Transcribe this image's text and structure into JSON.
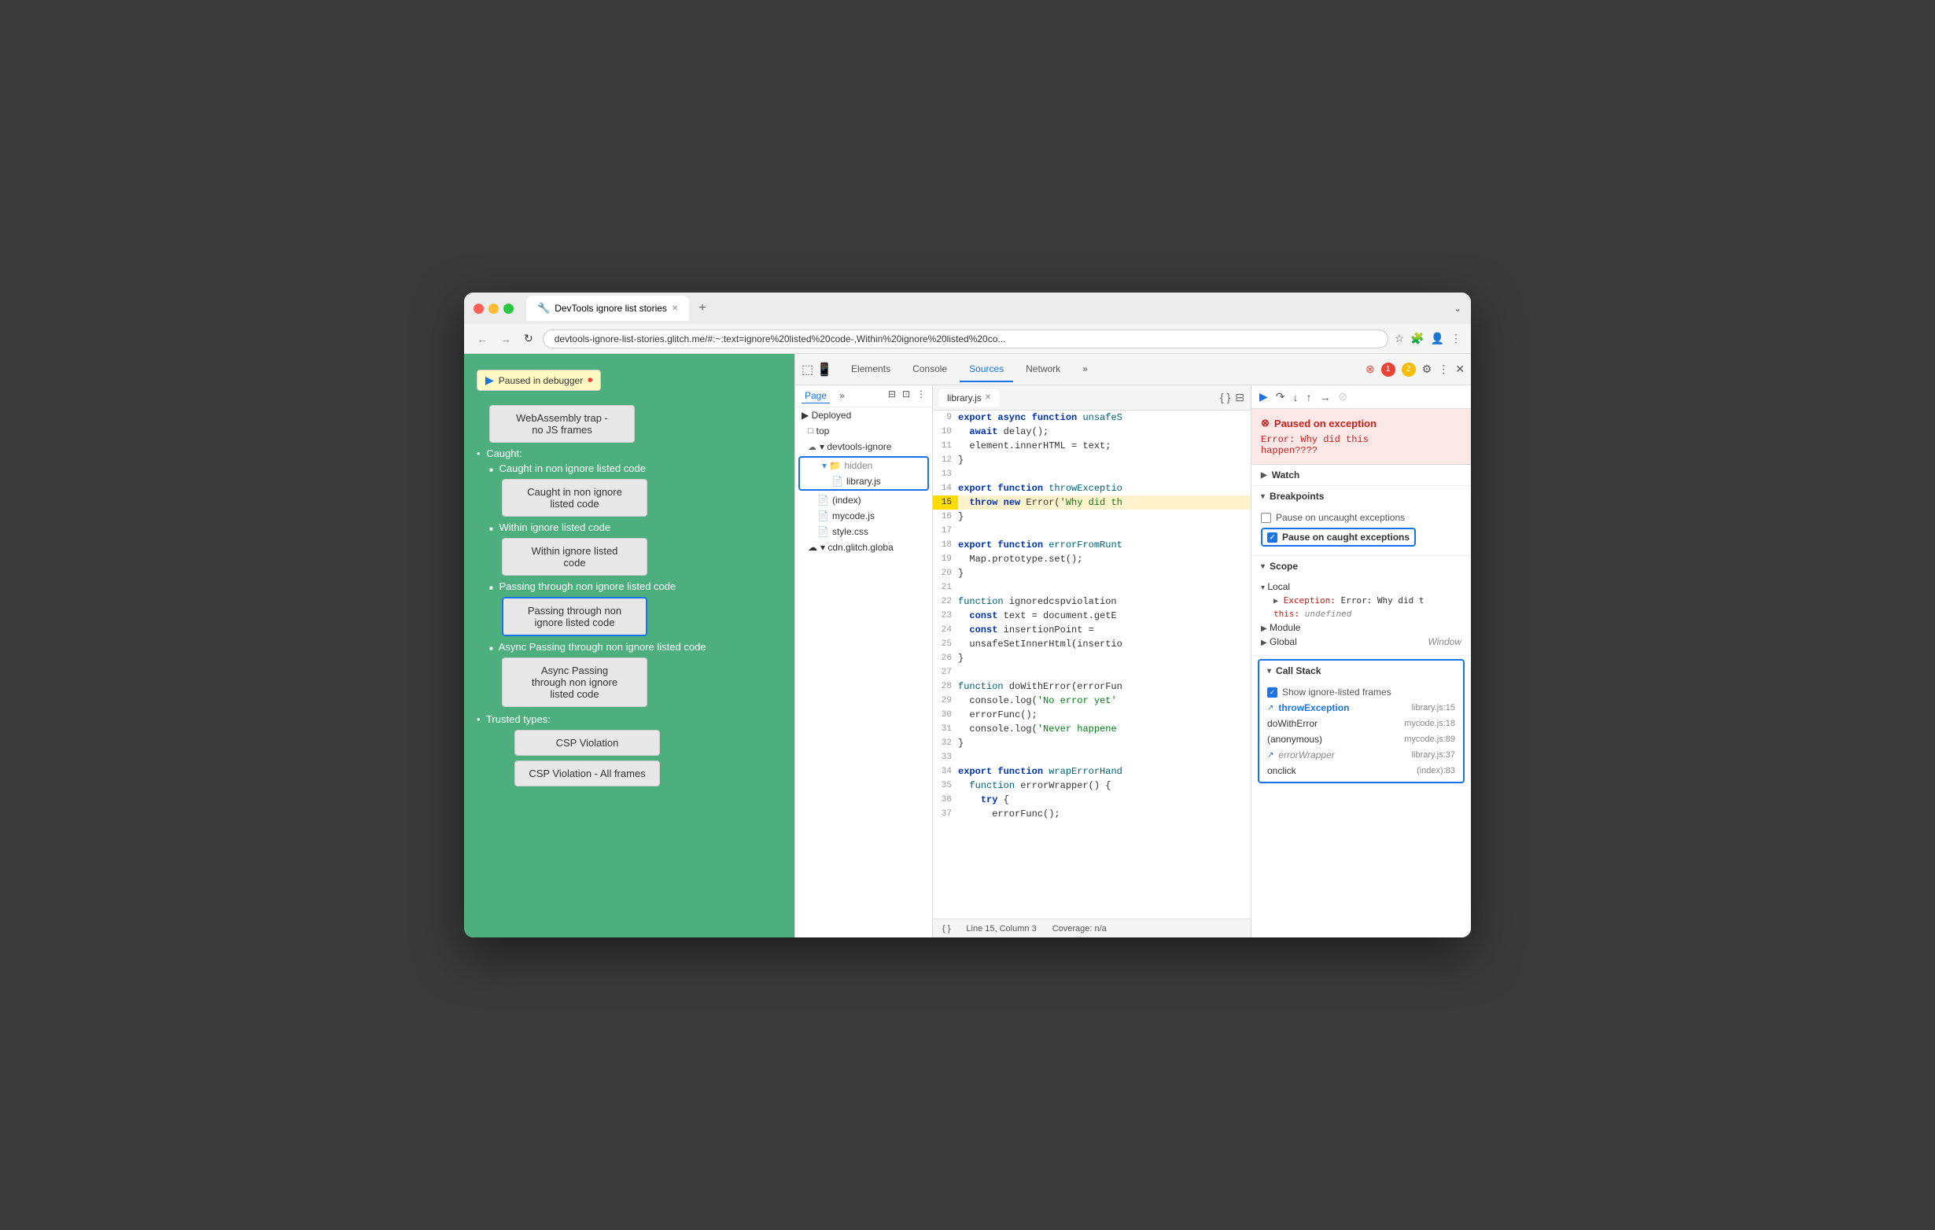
{
  "window": {
    "title": "DevTools ignore list stories",
    "url": "devtools-ignore-list-stories.glitch.me/#:~:text=ignore%20listed%20code-,Within%20ignore%20listed%20co..."
  },
  "browser": {
    "back": "←",
    "forward": "→",
    "refresh": "↻",
    "menu": "⋮"
  },
  "webpage": {
    "paused_label": "Paused in debugger",
    "webasm_label": "WebAssembly trap - no JS frames",
    "caught_heading": "Caught:",
    "items": [
      {
        "label": "Caught in non ignore listed code",
        "has_button": true,
        "button_label": "Caught in non ignore\nlisted code",
        "highlighted": false
      },
      {
        "label": "Within ignore listed code",
        "has_button": true,
        "button_label": "Within ignore listed\ncode",
        "highlighted": false
      },
      {
        "label": "Passing through non ignore listed code",
        "has_button": true,
        "button_label": "Passing through non\nignore listed code",
        "highlighted": true
      },
      {
        "label": "Async Passing through non ignore listed code",
        "has_button": true,
        "button_label": "Async Passing\nthrough non ignore\nlisted code",
        "highlighted": false
      }
    ],
    "trusted_heading": "Trusted types:",
    "csp_items": [
      {
        "label": "CSP Violation"
      },
      {
        "label": "CSP Violation - All frames"
      }
    ]
  },
  "devtools": {
    "tabs": [
      "Elements",
      "Console",
      "Sources",
      "Network",
      "»"
    ],
    "active_tab": "Sources",
    "error_count": "1",
    "warn_count": "2"
  },
  "sources": {
    "sidebar_tabs": [
      "Page",
      "»"
    ],
    "file_tree": {
      "items": [
        {
          "label": "Deployed",
          "type": "section",
          "indent": 0
        },
        {
          "label": "top",
          "type": "folder",
          "indent": 1,
          "icon": "□"
        },
        {
          "label": "devtools-ignore",
          "type": "cloud-folder",
          "indent": 1,
          "icon": "☁",
          "expanded": true
        },
        {
          "label": "hidden",
          "type": "folder",
          "indent": 2,
          "highlighted": true
        },
        {
          "label": "library.js",
          "type": "file-orange",
          "indent": 3
        },
        {
          "label": "(index)",
          "type": "file",
          "indent": 2
        },
        {
          "label": "mycode.js",
          "type": "file-red",
          "indent": 2
        },
        {
          "label": "style.css",
          "type": "file-red",
          "indent": 2
        },
        {
          "label": "cdn.glitch.globa",
          "type": "cloud-folder",
          "indent": 1,
          "icon": "☁"
        }
      ]
    },
    "active_file": "library.js",
    "code_lines": [
      {
        "num": 9,
        "content": "export async function unsafeS",
        "highlight": false
      },
      {
        "num": 10,
        "content": "  await delay();",
        "highlight": false
      },
      {
        "num": 11,
        "content": "  element.innerHTML = text;",
        "highlight": false
      },
      {
        "num": 12,
        "content": "}",
        "highlight": false
      },
      {
        "num": 13,
        "content": "",
        "highlight": false
      },
      {
        "num": 14,
        "content": "export function throwExceptio",
        "highlight": false
      },
      {
        "num": 15,
        "content": "  throw new Error('Why did th",
        "highlight": true
      },
      {
        "num": 16,
        "content": "}",
        "highlight": false
      },
      {
        "num": 17,
        "content": "",
        "highlight": false
      },
      {
        "num": 18,
        "content": "export function errorFromRunt",
        "highlight": false
      },
      {
        "num": 19,
        "content": "  Map.prototype.set();",
        "highlight": false
      },
      {
        "num": 20,
        "content": "}",
        "highlight": false
      },
      {
        "num": 21,
        "content": "",
        "highlight": false
      },
      {
        "num": 22,
        "content": "function ignoredcspviolation",
        "highlight": false
      },
      {
        "num": 23,
        "content": "  const text = document.getE",
        "highlight": false
      },
      {
        "num": 24,
        "content": "  const insertionPoint =",
        "highlight": false
      },
      {
        "num": 25,
        "content": "  unsafeSetInnerHtml(insertio",
        "highlight": false
      },
      {
        "num": 26,
        "content": "}",
        "highlight": false
      },
      {
        "num": 27,
        "content": "",
        "highlight": false
      },
      {
        "num": 28,
        "content": "function doWithError(errorFun",
        "highlight": false
      },
      {
        "num": 29,
        "content": "  console.log('No error yet'",
        "highlight": false
      },
      {
        "num": 30,
        "content": "  errorFunc();",
        "highlight": false
      },
      {
        "num": 31,
        "content": "  console.log('Never happene",
        "highlight": false
      },
      {
        "num": 32,
        "content": "}",
        "highlight": false
      },
      {
        "num": 33,
        "content": "",
        "highlight": false
      },
      {
        "num": 34,
        "content": "export function wrapErrorHand",
        "highlight": false
      },
      {
        "num": 35,
        "content": "  function errorWrapper() {",
        "highlight": false
      },
      {
        "num": 36,
        "content": "    try {",
        "highlight": false
      },
      {
        "num": 37,
        "content": "      errorFunc();",
        "highlight": false
      }
    ],
    "status_line": "Line 15, Column 3",
    "coverage": "Coverage: n/a"
  },
  "right_panel": {
    "exception": {
      "title": "Paused on exception",
      "message": "Error: Why did this\nhappen????"
    },
    "sections": [
      {
        "id": "watch",
        "label": "Watch",
        "collapsed": true
      },
      {
        "id": "breakpoints",
        "label": "Breakpoints",
        "collapsed": false
      },
      {
        "id": "scope",
        "label": "Scope",
        "collapsed": false
      },
      {
        "id": "callstack",
        "label": "Call Stack",
        "collapsed": false
      }
    ],
    "breakpoints": {
      "uncaught_label": "Pause on uncaught exceptions",
      "uncaught_checked": false,
      "caught_label": "Pause on caught exceptions",
      "caught_checked": true
    },
    "scope": {
      "local_label": "Local",
      "exception_label": "Exception: Error: Why did t",
      "this_label": "this:",
      "this_val": "undefined",
      "module_label": "Module",
      "global_label": "Global",
      "global_val": "Window"
    },
    "call_stack": {
      "show_ignore_label": "Show ignore-listed frames",
      "show_ignore_checked": true,
      "frames": [
        {
          "name": "throwException",
          "loc": "library.js:15",
          "type": "ignore",
          "active": true
        },
        {
          "name": "doWithError",
          "loc": "mycode.js:18",
          "type": "normal",
          "active": false
        },
        {
          "name": "(anonymous)",
          "loc": "mycode.js:89",
          "type": "normal",
          "active": false
        },
        {
          "name": "errorWrapper",
          "loc": "library.js:37",
          "type": "ignore",
          "active": false
        },
        {
          "name": "onclick",
          "loc": "(index):83",
          "type": "normal",
          "active": false
        }
      ]
    }
  }
}
